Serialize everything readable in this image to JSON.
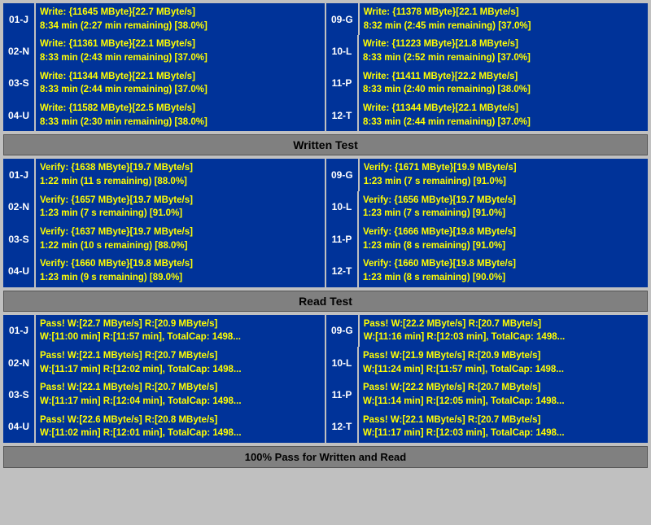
{
  "sections": {
    "written_test": {
      "label": "Written Test",
      "rows": [
        {
          "left": {
            "id": "01-J",
            "line1": "Write: {11645 MByte}[22.7 MByte/s]",
            "line2": "8:34 min (2:27 min remaining)  [38.0%]"
          },
          "right": {
            "id": "09-G",
            "line1": "Write: {11378 MByte}[22.1 MByte/s]",
            "line2": "8:32 min (2:45 min remaining)  [37.0%]"
          }
        },
        {
          "left": {
            "id": "02-N",
            "line1": "Write: {11361 MByte}[22.1 MByte/s]",
            "line2": "8:33 min (2:43 min remaining)  [37.0%]"
          },
          "right": {
            "id": "10-L",
            "line1": "Write: {11223 MByte}[21.8 MByte/s]",
            "line2": "8:33 min (2:52 min remaining)  [37.0%]"
          }
        },
        {
          "left": {
            "id": "03-S",
            "line1": "Write: {11344 MByte}[22.1 MByte/s]",
            "line2": "8:33 min (2:44 min remaining)  [37.0%]"
          },
          "right": {
            "id": "11-P",
            "line1": "Write: {11411 MByte}[22.2 MByte/s]",
            "line2": "8:33 min (2:40 min remaining)  [38.0%]"
          }
        },
        {
          "left": {
            "id": "04-U",
            "line1": "Write: {11582 MByte}[22.5 MByte/s]",
            "line2": "8:33 min (2:30 min remaining)  [38.0%]"
          },
          "right": {
            "id": "12-T",
            "line1": "Write: {11344 MByte}[22.1 MByte/s]",
            "line2": "8:33 min (2:44 min remaining)  [37.0%]"
          }
        }
      ]
    },
    "verify_test": {
      "label": "Written Test",
      "rows": [
        {
          "left": {
            "id": "01-J",
            "line1": "Verify: {1638 MByte}[19.7 MByte/s]",
            "line2": "1:22 min (11 s remaining)   [88.0%]"
          },
          "right": {
            "id": "09-G",
            "line1": "Verify: {1671 MByte}[19.9 MByte/s]",
            "line2": "1:23 min (7 s remaining)   [91.0%]"
          }
        },
        {
          "left": {
            "id": "02-N",
            "line1": "Verify: {1657 MByte}[19.7 MByte/s]",
            "line2": "1:23 min (7 s remaining)   [91.0%]"
          },
          "right": {
            "id": "10-L",
            "line1": "Verify: {1656 MByte}[19.7 MByte/s]",
            "line2": "1:23 min (7 s remaining)   [91.0%]"
          }
        },
        {
          "left": {
            "id": "03-S",
            "line1": "Verify: {1637 MByte}[19.7 MByte/s]",
            "line2": "1:22 min (10 s remaining)   [88.0%]"
          },
          "right": {
            "id": "11-P",
            "line1": "Verify: {1666 MByte}[19.8 MByte/s]",
            "line2": "1:23 min (8 s remaining)   [91.0%]"
          }
        },
        {
          "left": {
            "id": "04-U",
            "line1": "Verify: {1660 MByte}[19.8 MByte/s]",
            "line2": "1:23 min (9 s remaining)   [89.0%]"
          },
          "right": {
            "id": "12-T",
            "line1": "Verify: {1660 MByte}[19.8 MByte/s]",
            "line2": "1:23 min (8 s remaining)   [90.0%]"
          }
        }
      ]
    },
    "read_test": {
      "label": "Read Test",
      "rows": [
        {
          "left": {
            "id": "01-J",
            "line1": "Pass! W:[22.7 MByte/s] R:[20.9 MByte/s]",
            "line2": "W:[11:00 min] R:[11:57 min], TotalCap: 1498..."
          },
          "right": {
            "id": "09-G",
            "line1": "Pass! W:[22.2 MByte/s] R:[20.7 MByte/s]",
            "line2": "W:[11:16 min] R:[12:03 min], TotalCap: 1498..."
          }
        },
        {
          "left": {
            "id": "02-N",
            "line1": "Pass! W:[22.1 MByte/s] R:[20.7 MByte/s]",
            "line2": "W:[11:17 min] R:[12:02 min], TotalCap: 1498..."
          },
          "right": {
            "id": "10-L",
            "line1": "Pass! W:[21.9 MByte/s] R:[20.9 MByte/s]",
            "line2": "W:[11:24 min] R:[11:57 min], TotalCap: 1498..."
          }
        },
        {
          "left": {
            "id": "03-S",
            "line1": "Pass! W:[22.1 MByte/s] R:[20.7 MByte/s]",
            "line2": "W:[11:17 min] R:[12:04 min], TotalCap: 1498..."
          },
          "right": {
            "id": "11-P",
            "line1": "Pass! W:[22.2 MByte/s] R:[20.7 MByte/s]",
            "line2": "W:[11:14 min] R:[12:05 min], TotalCap: 1498..."
          }
        },
        {
          "left": {
            "id": "04-U",
            "line1": "Pass! W:[22.6 MByte/s] R:[20.8 MByte/s]",
            "line2": "W:[11:02 min] R:[12:01 min], TotalCap: 1498..."
          },
          "right": {
            "id": "12-T",
            "line1": "Pass! W:[22.1 MByte/s] R:[20.7 MByte/s]",
            "line2": "W:[11:17 min] R:[12:03 min], TotalCap: 1498..."
          }
        }
      ]
    }
  },
  "headers": {
    "written_test": "Written Test",
    "read_test": "Read Test"
  },
  "footer": "100% Pass for Written and Read"
}
